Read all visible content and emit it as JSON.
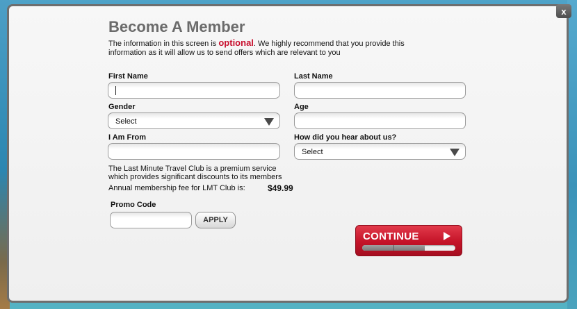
{
  "dialog": {
    "close_label": "x",
    "title": "Become A Member",
    "intro_before": "The information in this screen is ",
    "intro_optional": "optional",
    "intro_after": ". We highly recommend that you provide this information as it will allow us to send offers which are relevant to you"
  },
  "form": {
    "first_name": {
      "label": "First Name",
      "value": ""
    },
    "last_name": {
      "label": "Last Name",
      "value": ""
    },
    "gender": {
      "label": "Gender",
      "selected": "Select"
    },
    "age": {
      "label": "Age",
      "value": ""
    },
    "from": {
      "label": "I Am From",
      "value": ""
    },
    "referral": {
      "label": "How did you hear about us?",
      "selected": "Select"
    }
  },
  "membership": {
    "info": "The Last Minute Travel Club is a premium service which provides significant discounts to its members",
    "fee_label": "Annual membership fee for LMT Club is:",
    "fee_value": "$49.99"
  },
  "promo": {
    "label": "Promo Code",
    "value": "",
    "apply_label": "APPLY"
  },
  "continue": {
    "label": "CONTINUE",
    "progress_fraction": 0.67
  },
  "colors": {
    "accent_red": "#c8102e",
    "title_gray": "#6b6b6b"
  },
  "icons": {
    "close": "close-icon",
    "dropdown": "chevron-down-icon",
    "continue": "play-arrow-icon"
  }
}
